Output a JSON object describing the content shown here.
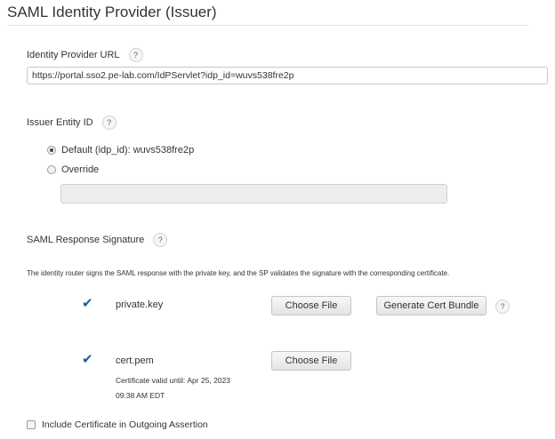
{
  "page": {
    "title": "SAML Identity Provider (Issuer)"
  },
  "idp_url": {
    "label": "Identity Provider URL",
    "value": "https://portal.sso2.pe-lab.com/IdPServlet?idp_id=wuvs538fre2p"
  },
  "issuer": {
    "label": "Issuer Entity ID",
    "default_option": "Default (idp_id): wuvs538fre2p",
    "override_option": "Override",
    "override_value": "",
    "selected": "default"
  },
  "signature": {
    "label": "SAML Response Signature",
    "description": "The identity router signs the SAML response with the private key, and the SP validates the signature with the corresponding certificate.",
    "private_key": {
      "name": "private.key",
      "choose_label": "Choose File",
      "generate_label": "Generate Cert Bundle"
    },
    "cert": {
      "name": "cert.pem",
      "choose_label": "Choose File",
      "note": "Certificate valid until: Apr 25, 2023 09:38 AM EDT"
    }
  },
  "include_cert": {
    "label": "Include Certificate in Outgoing Assertion",
    "checked": false
  },
  "help_glyph": "?",
  "check_glyph": "✔"
}
